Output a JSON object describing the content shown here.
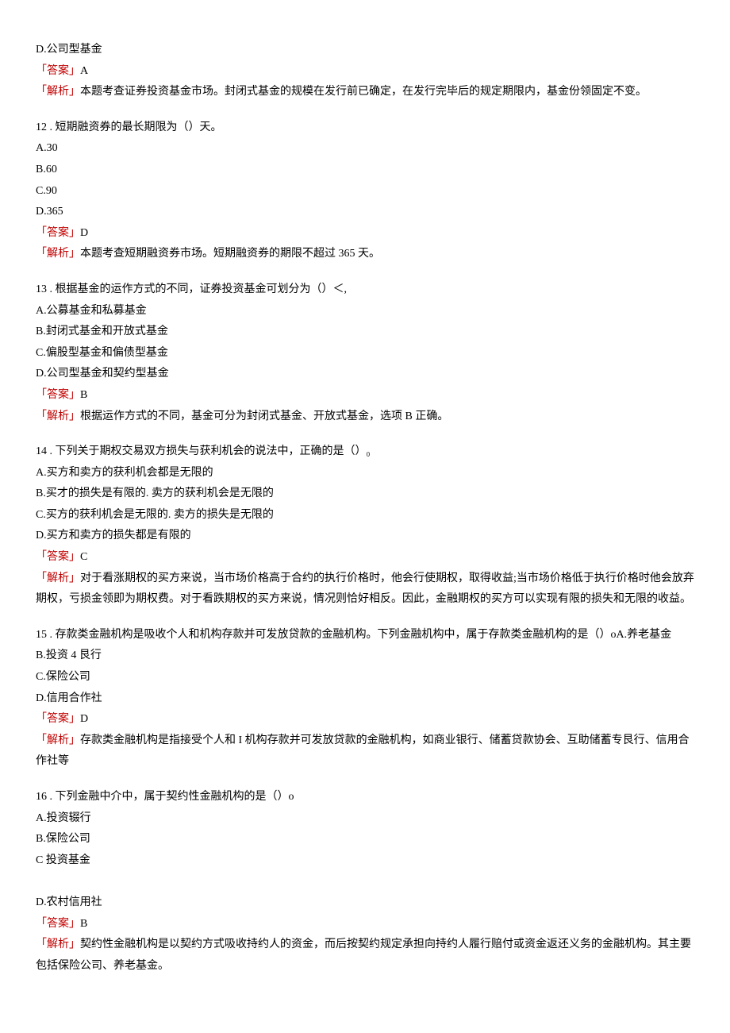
{
  "labels": {
    "answer_open": "「答案」",
    "analysis_open": "「解析」"
  },
  "items": [
    {
      "options": [
        "D.公司型基金"
      ],
      "answer": "A",
      "analysis": "本题考查证券投资基金市场。封闭式基金的规模在发行前已确定，在发行完毕后的规定期限内，基金份领固定不变。"
    },
    {
      "stem": "12    . 短期融资券的最长期限为（）天。",
      "options": [
        "A.30",
        "B.60",
        "C.90",
        "D.365"
      ],
      "answer": "D",
      "analysis": "本题考查短期融资券市场。短期融资券的期限不超过 365 天。"
    },
    {
      "stem": "13    . 根据基金的运作方式的不同，证券投资基金可划分为（）＜,",
      "options": [
        "A.公募基金和私募基金",
        "B.封闭式基金和开放式基金",
        "C.偏股型基金和偏债型基金",
        "D.公司型基金和契约型基金"
      ],
      "answer": "B",
      "analysis": "根据运作方式的不同，基金可分为封闭式基金、开放式基金，选项 B 正确。"
    },
    {
      "stem": "14    . 下列关于期权交易双方损失与获利机会的说法中，正确的是（）₀",
      "options": [
        "A.买方和卖方的获利机会都是无限的",
        "B.买才的损失是有限的. 卖方的获利机会是无限的",
        "C.买方的获利机会是无限的. 卖方的损失是无限的",
        "D.买方和卖方的损失都是有限的"
      ],
      "answer": "C",
      "analysis": "对于看涨期权的买方来说，当市场价格高于合约的执行价格时，他会行使期权，取得收益;当市场价格低于执行价格时他会放弃期权，亏损金领即为期权费。对于看跌期权的买方来说，情况则恰好相反。因此，金融期权的买方可以实现有限的损失和无限的收益。"
    },
    {
      "stem": "15    . 存款类金融机构是吸收个人和机构存款并可发放贷款的金融机构。下列金融机构中，属于存款类金融机构的是（）oA.养老基金",
      "options": [
        "B.投资 4 艮行",
        "C.保险公司",
        "D.信用合作社"
      ],
      "answer": "D",
      "analysis": "存款类金融机构是指接受个人和 I 机构存款并可发放贷款的金融机构，如商业银行、储蓄贷款协会、互助储蓄专艮行、信用合作社等"
    },
    {
      "stem": "16    . 下列金融中介中，属于契约性金融机构的是（）o",
      "options": [
        "A.投资辍行",
        "B.保险公司",
        "C 投资基金"
      ],
      "extra": [
        "D.农村信用社"
      ],
      "answer": "B",
      "analysis": "契约性金融机构是以契约方式吸收持约人的资金，而后按契约规定承担向持约人履行赔付或资金返还义务的金融机构。其主要包括保险公司、养老基金。"
    }
  ]
}
